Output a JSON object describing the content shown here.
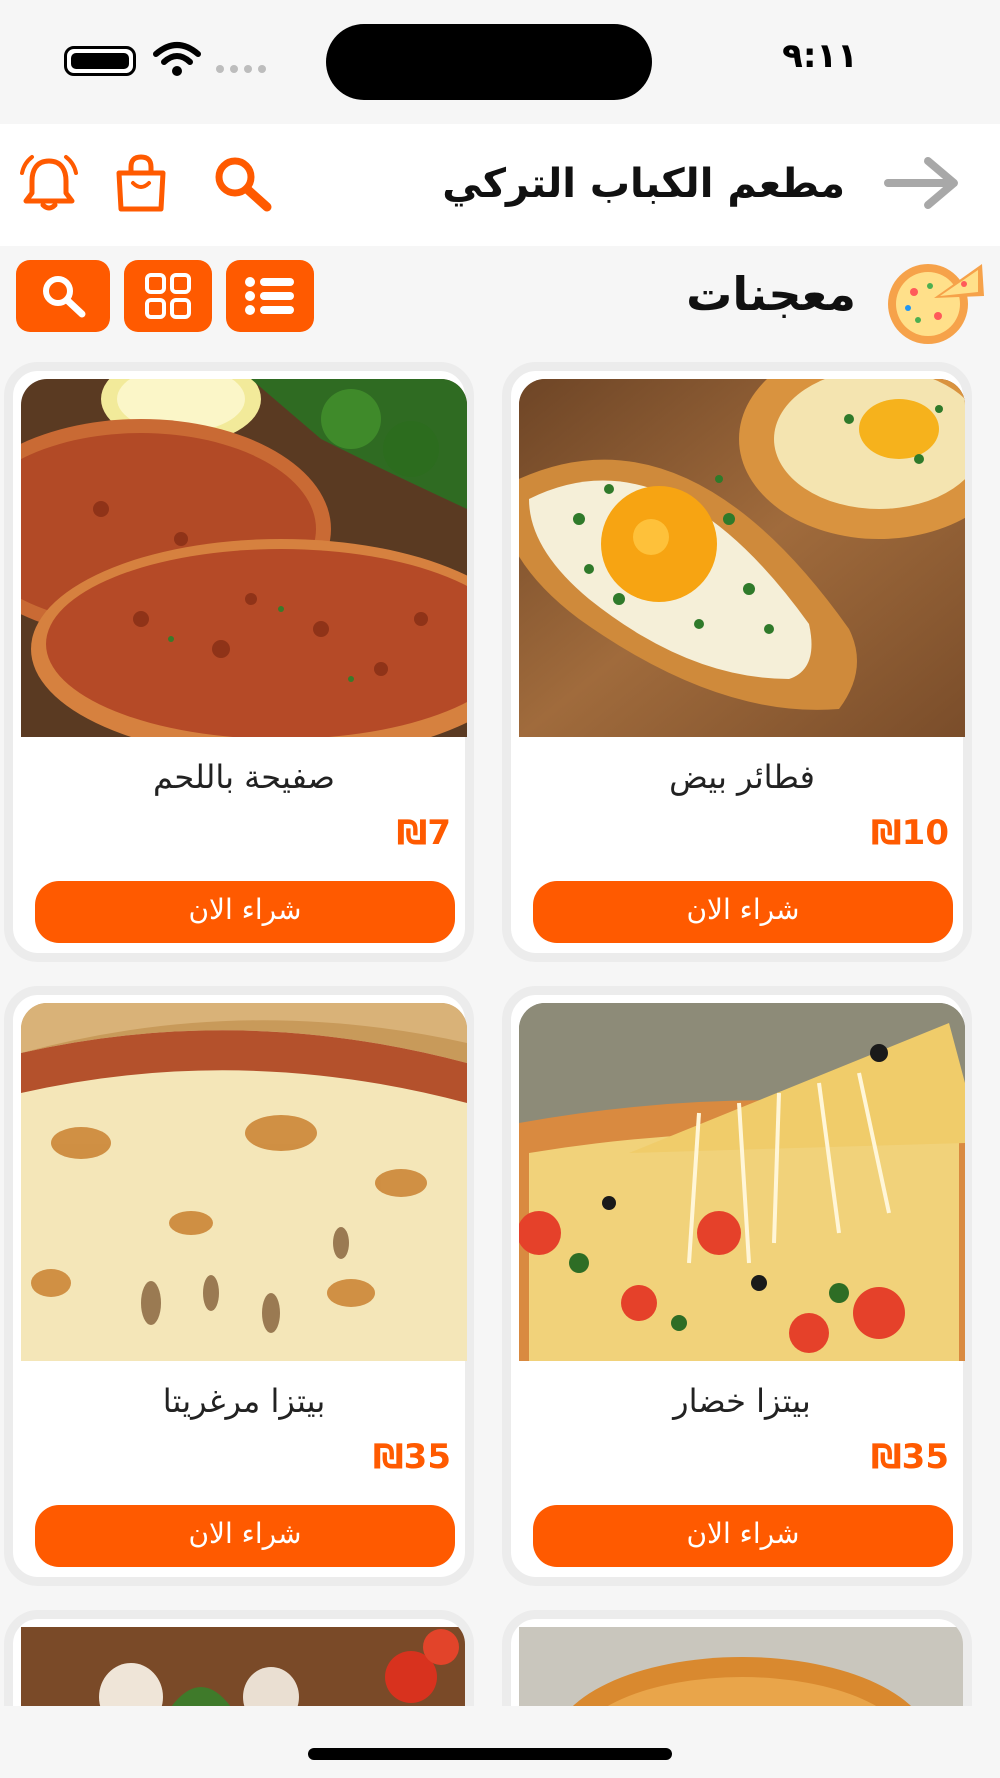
{
  "status_bar": {
    "time": "٩:١١"
  },
  "header": {
    "title": "مطعم الكباب التركي",
    "icons": [
      "back-arrow-icon",
      "search-icon",
      "shopping-bag-icon",
      "bell-icon"
    ]
  },
  "category": {
    "title": "معجنات",
    "icon": "pizza-slice-icon",
    "buttons": [
      "list-view-icon",
      "grid-view-icon",
      "search-icon"
    ]
  },
  "accent_color": "#ff5a00",
  "products": [
    {
      "name": "فطائر بيض",
      "price": "₪10",
      "buy_label": "شراء الان"
    },
    {
      "name": "صفيحة باللحم",
      "price": "₪7",
      "buy_label": "شراء الان"
    },
    {
      "name": "بيتزا خضار",
      "price": "₪35",
      "buy_label": "شراء الان"
    },
    {
      "name": "بيتزا مرغريتا",
      "price": "₪35",
      "buy_label": "شراء الان"
    }
  ]
}
